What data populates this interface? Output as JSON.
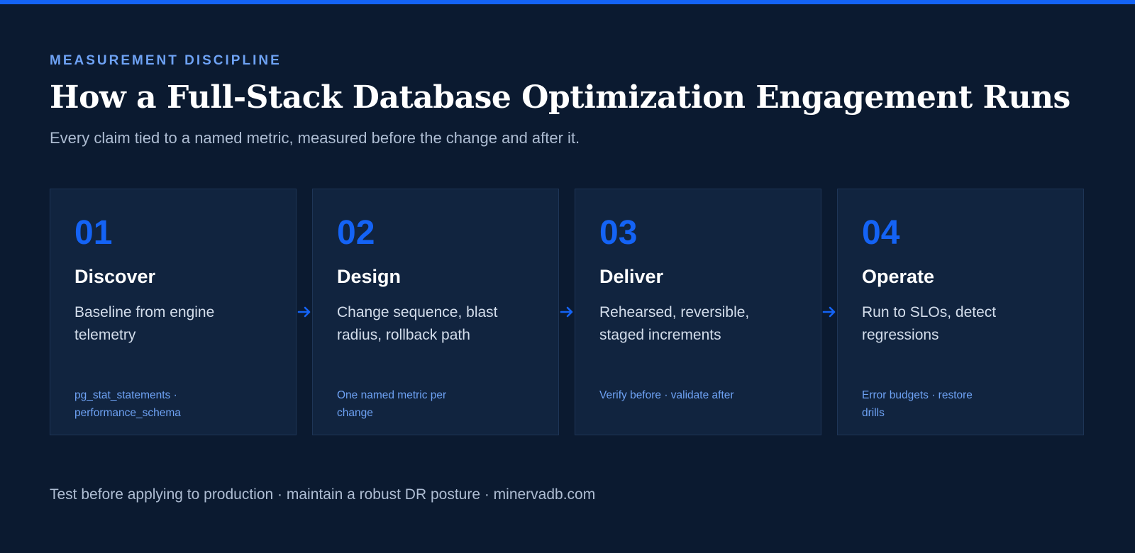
{
  "header": {
    "eyebrow": "MEASUREMENT DISCIPLINE",
    "title": "How a Full-Stack Database Optimization Engagement Runs",
    "subtitle": "Every claim tied to a named metric, measured before the change and after it."
  },
  "steps": [
    {
      "number": "01",
      "title": "Discover",
      "description": "Baseline from engine telemetry",
      "footnote": "pg_stat_statements · performance_schema"
    },
    {
      "number": "02",
      "title": "Design",
      "description": "Change sequence, blast radius, rollback path",
      "footnote": "One named metric per change"
    },
    {
      "number": "03",
      "title": "Deliver",
      "description": "Rehearsed, reversible, staged increments",
      "footnote": "Verify before · validate after"
    },
    {
      "number": "04",
      "title": "Operate",
      "description": "Run to SLOs, detect regressions",
      "footnote": "Error budgets · restore drills"
    }
  ],
  "footer": {
    "text": "Test before applying to production · maintain a robust DR posture · minervadb.com"
  },
  "colors": {
    "background": "#0b1a30",
    "card": "#11243f",
    "accent": "#1463f5",
    "accent_light": "#6ea2f4"
  },
  "icons": {
    "connector": "arrow-right-icon"
  }
}
